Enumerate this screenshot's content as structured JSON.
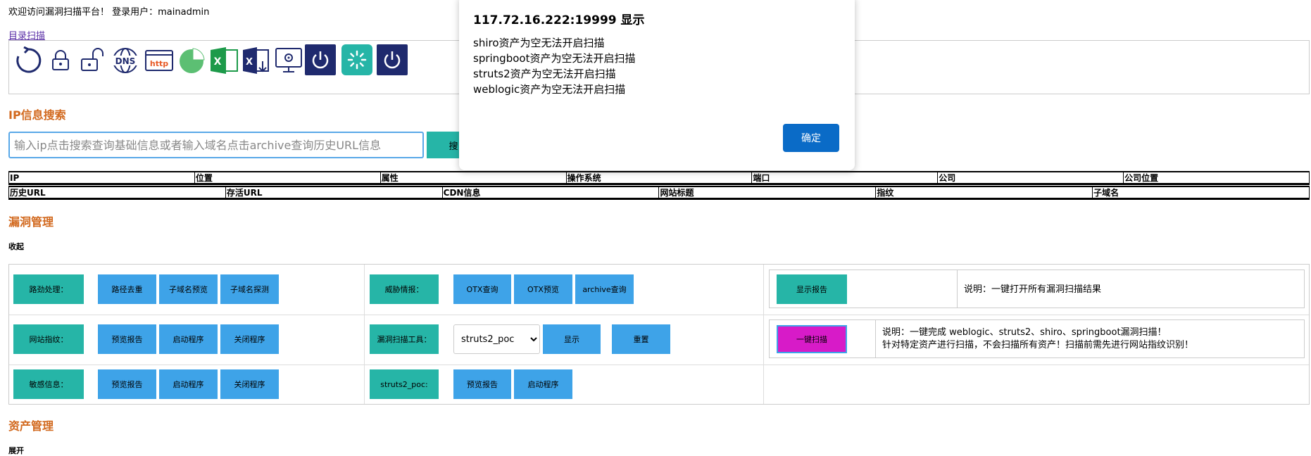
{
  "header": {
    "welcome": "欢迎访问漏洞扫描平台！ 登录用户：mainadmin",
    "dir_scan_link": "目录扫描"
  },
  "icons": [
    "refresh-icon",
    "lock-icon",
    "unlock-icon",
    "lock-open-icon",
    "dns-icon",
    "http-icon",
    "pie-chart-icon",
    "excel-icon",
    "excel-download-icon",
    "monitor-settings-icon",
    "power-icon",
    "loading-icon",
    "power-dark-icon"
  ],
  "ip_search": {
    "title": "IP信息搜索",
    "placeholder": "输入ip点击搜索查询基础信息或者输入域名点击archive查询历史URL信息",
    "search_label": "搜"
  },
  "info_table_1": [
    "IP",
    "位置",
    "属性",
    "操作系统",
    "端口",
    "公司",
    "公司位置"
  ],
  "info_table_2": [
    "历史URL",
    "存活URL",
    "CDN信息",
    "网站标题",
    "指纹",
    "子域名"
  ],
  "vuln": {
    "title": "漏洞管理",
    "collapse_label": "收起",
    "row1": {
      "path_label": "路劲处理：",
      "dedupe": "路径去重",
      "subdomain_preview": "子域名预览",
      "subdomain_probe": "子域名探测",
      "intel_label": "威胁情报：",
      "otx_query": "OTX查询",
      "otx_preview": "OTX预览",
      "archive_query": "archive查询",
      "show_report": "显示报告",
      "show_report_desc": "说明：一键打开所有漏洞扫描结果"
    },
    "row2": {
      "fingerprint_label": "网站指纹：",
      "preview_report": "预览报告",
      "start_program": "启动程序",
      "close_program": "关闭程序",
      "tool_label": "漏洞扫描工具：",
      "tool_selected": "struts2_poc",
      "show": "显示",
      "reset": "重置",
      "one_click_scan": "一键扫描",
      "one_click_desc_1": "说明：一键完成 weblogic、struts2、shiro、springboot漏洞扫描！",
      "one_click_desc_2": "针对特定资产进行扫描，不会扫描所有资产！扫描前需先进行网站指纹识别！"
    },
    "row3": {
      "sensitive_label": "敏感信息：",
      "preview_report": "预览报告",
      "start_program": "启动程序",
      "close_program": "关闭程序",
      "struts_label": "struts2_poc:",
      "struts_preview": "预览报告",
      "struts_start": "启动程序"
    }
  },
  "assets": {
    "title": "资产管理",
    "expand_label": "展开"
  },
  "dialog": {
    "title": "117.72.16.222:19999 显示",
    "lines": [
      "shiro资产为空无法开启扫描",
      "springboot资产为空无法开启扫描",
      "struts2资产为空无法开启扫描",
      "weblogic资产为空无法开启扫描"
    ],
    "ok_label": "确定"
  },
  "colors": {
    "teal": "#26b5a7",
    "blue": "#3ea3e8",
    "magenta": "#d71bc8",
    "section": "#d2691e",
    "dialog_ok": "#0a6bc7"
  }
}
